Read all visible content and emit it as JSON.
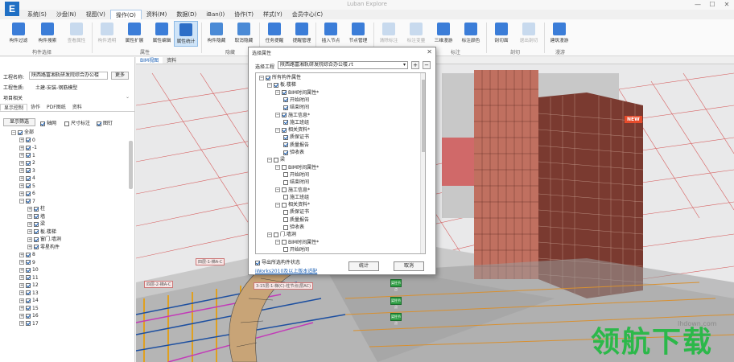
{
  "app": {
    "title": "Luban Explore"
  },
  "menu": [
    "系统(S)",
    "沙盘(N)",
    "视图(V)",
    "操作(O)",
    "资料(M)",
    "数据(D)",
    "iBan(I)",
    "协作(T)",
    "样式(Y)",
    "会员中心(C)"
  ],
  "ribbon": {
    "buttons": [
      "构件过滤",
      "构件搜索",
      "查看属性",
      "构件透明",
      "属性扩展",
      "属性编辑",
      "属性统计",
      "构件隐藏",
      "取消隐藏",
      "任务提醒",
      "提醒管理",
      "插入节点",
      "节点管理",
      "清除标注",
      "标注变量",
      "三维漫游",
      "标注颜色",
      "剖切面",
      "退出剖切",
      "建筑漫游"
    ],
    "groups": [
      "构件选择",
      "属性",
      "隐藏",
      "标注",
      "剖切",
      "漫游"
    ]
  },
  "left": {
    "project_label": "工程名称:",
    "project_value": "陕西路富湘轨研发院综合办公楼",
    "more_btn": "更多",
    "type_label": "工程性质:",
    "type_value": "土建-安装-钢筋模型",
    "section": "项目相关",
    "tabs": [
      "显示控制",
      "协作",
      "PDF图纸",
      "资料"
    ],
    "filter_btn": "显示筛选",
    "checks": [
      "轴网",
      "尺寸标注",
      "图钉"
    ],
    "tree_root": "全部",
    "floors": [
      "0",
      "-1",
      "1",
      "2",
      "3",
      "4",
      "5",
      "6",
      "7"
    ],
    "floor7_children": [
      "柱",
      "墙",
      "梁",
      "板.楼梯",
      "窗门.墙洞",
      "零星构件"
    ],
    "floors_after": [
      "8",
      "9",
      "10",
      "11",
      "12",
      "13",
      "14",
      "15",
      "16",
      "17"
    ]
  },
  "viewport": {
    "tabs": [
      "BIM视图",
      "资料"
    ],
    "new_badge": "NEW"
  },
  "callouts": [
    "四层-1-梯A-C",
    "2-5",
    "四层-2-梯A-C",
    "3-15层-1-梯(C)-柱节点(层AC)"
  ],
  "gtags": [
    "梁柱节点",
    "梁柱节点",
    "梁柱节点"
  ],
  "dialog": {
    "title": "选择属性",
    "project_label": "选择工程",
    "project_value": "陕西路富湘轨研发院综合办公楼.rt",
    "tree": [
      {
        "label": "所有构件属性",
        "level": 0,
        "check": "on",
        "exp": "−"
      },
      {
        "label": "板.楼梯",
        "level": 1,
        "check": "on",
        "exp": "−"
      },
      {
        "label": "BIM时间属性*",
        "level": 2,
        "check": "on",
        "exp": "−"
      },
      {
        "label": "开始时间",
        "level": 3,
        "check": "on"
      },
      {
        "label": "结束时间",
        "level": 3,
        "check": "on"
      },
      {
        "label": "施工信息*",
        "level": 2,
        "check": "on",
        "exp": "−"
      },
      {
        "label": "施工班组",
        "level": 3,
        "check": "on"
      },
      {
        "label": "相关资料*",
        "level": 2,
        "check": "on",
        "exp": "−"
      },
      {
        "label": "质保证书",
        "level": 3,
        "check": "on"
      },
      {
        "label": "质量报告",
        "level": 3,
        "check": "on"
      },
      {
        "label": "验收表",
        "level": 3,
        "check": "on"
      },
      {
        "label": "梁",
        "level": 1,
        "check": "off",
        "exp": "−"
      },
      {
        "label": "BIM时间属性*",
        "level": 2,
        "check": "off",
        "exp": "−"
      },
      {
        "label": "开始时间",
        "level": 3,
        "check": "off"
      },
      {
        "label": "结束时间",
        "level": 3,
        "check": "off"
      },
      {
        "label": "施工信息*",
        "level": 2,
        "check": "off",
        "exp": "−"
      },
      {
        "label": "施工班组",
        "level": 3,
        "check": "off"
      },
      {
        "label": "相关资料*",
        "level": 2,
        "check": "off",
        "exp": "−"
      },
      {
        "label": "质保证书",
        "level": 3,
        "check": "off"
      },
      {
        "label": "质量报告",
        "level": 3,
        "check": "off"
      },
      {
        "label": "验收表",
        "level": 3,
        "check": "off"
      },
      {
        "label": "门.墙洞",
        "level": 1,
        "check": "off",
        "exp": "−"
      },
      {
        "label": "BIM时间属性*",
        "level": 2,
        "check": "off",
        "exp": "−"
      },
      {
        "label": "开始时间",
        "level": 3,
        "check": "off"
      }
    ],
    "export_label": "导出所选构件状态",
    "link": "iWorks2010及以上版本适配",
    "ok": "统计",
    "cancel": "取消"
  },
  "watermark": {
    "text": "领航下载",
    "url": "lhdown.com"
  }
}
